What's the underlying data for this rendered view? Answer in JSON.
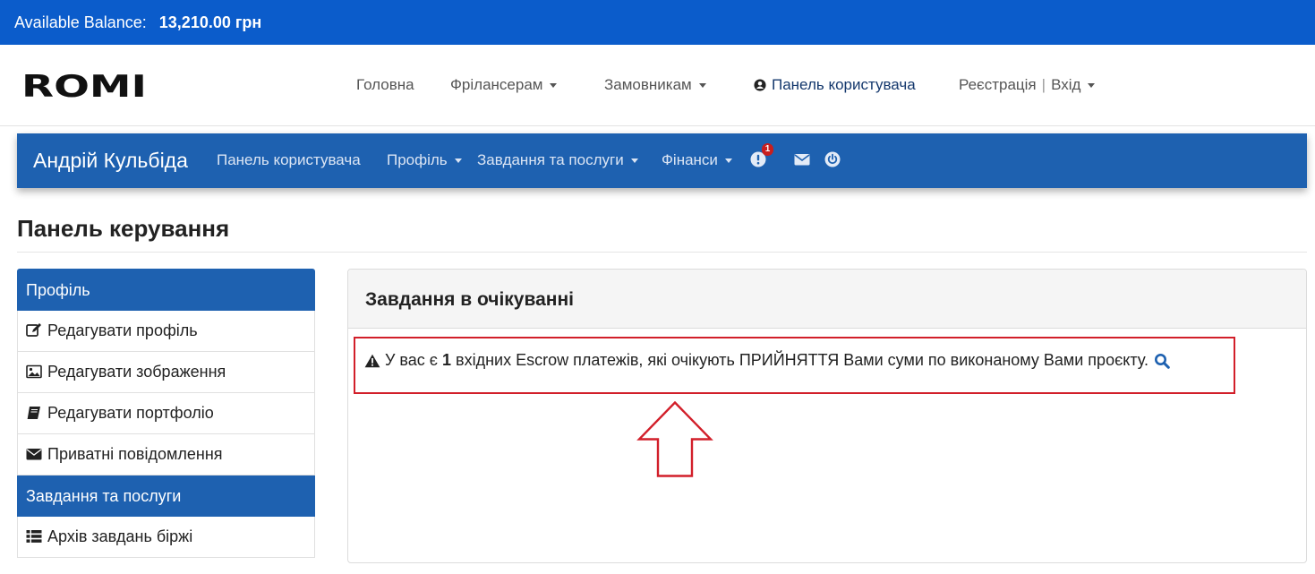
{
  "balance": {
    "label": "Available Balance:",
    "amount": "13,210.00 грн"
  },
  "logo": {
    "text": "ROMI"
  },
  "main_nav": [
    {
      "label": "Головна"
    },
    {
      "label": "Фрілансерам"
    },
    {
      "label": "Замовникам"
    },
    {
      "label": "Панель користувача"
    },
    {
      "label": "Реєстрація"
    },
    {
      "label": "Вхід"
    }
  ],
  "dashboard_nav": {
    "user_name": "Андрій Кульбіда",
    "links": [
      {
        "label": "Панель користувача"
      },
      {
        "label": "Профіль"
      },
      {
        "label": "Завдання та послуги"
      },
      {
        "label": "Фінанси"
      }
    ],
    "alerts_badge": "1",
    "icons": [
      "exclamation-circle-icon",
      "envelope-icon",
      "power-icon"
    ]
  },
  "page": {
    "title": "Панель керування"
  },
  "sidebar": {
    "sections": [
      {
        "title": "Профіль",
        "items": [
          {
            "label": "Редагувати профіль",
            "icon": "edit-icon"
          },
          {
            "label": "Редагувати зображення",
            "icon": "image-icon"
          },
          {
            "label": "Редагувати портфоліо",
            "icon": "book-icon"
          },
          {
            "label": "Приватні повідомлення",
            "icon": "envelope-icon"
          }
        ]
      },
      {
        "title": "Завдання та послуги",
        "items": [
          {
            "label": "Архів завдань біржі",
            "icon": "list-icon"
          }
        ]
      }
    ]
  },
  "panel": {
    "title": "Завдання в очікуванні",
    "alert": {
      "prefix": "У вас є",
      "count": "1",
      "suffix": "вхідних Escrow платежів, які очікують ПРИЙНЯТТЯ Вами суми по виконаному Вами проєкту."
    }
  },
  "colors": {
    "balance_bar": "#0b5ccb",
    "dashboard_nav": "#1e61b0",
    "highlight_border": "#d21f2a",
    "badge": "#c81e1e"
  }
}
